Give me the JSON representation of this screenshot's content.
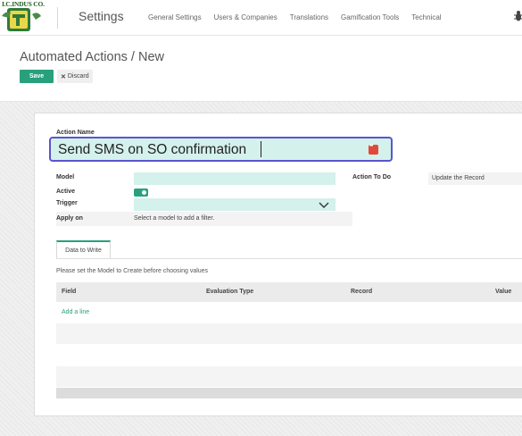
{
  "navbar": {
    "logo_text": "I.C.INDUS CO.",
    "app_title": "Settings",
    "menu": [
      "General Settings",
      "Users & Companies",
      "Translations",
      "Gamification Tools",
      "Technical"
    ],
    "icons": [
      "company-logo",
      "bug-icon"
    ]
  },
  "control_panel": {
    "breadcrumb": "Automated Actions / New",
    "save_label": "Save",
    "discard_label": "Discard"
  },
  "form": {
    "action_name_label": "Action Name",
    "action_name_value": "Send SMS on SO confirmation",
    "model_label": "Model",
    "model_value": "",
    "active_label": "Active",
    "active_value": true,
    "trigger_label": "Trigger",
    "trigger_value": "",
    "apply_on_label": "Apply on",
    "apply_on_value": "Select a model to add a filter.",
    "action_to_do_label": "Action To Do",
    "action_to_do_value": "Update the Record"
  },
  "notebook": {
    "tab_label": "Data to Write",
    "help_text": "Please set the Model to Create before choosing values",
    "columns": [
      "Field",
      "Evaluation Type",
      "Record",
      "Value"
    ],
    "add_line_label": "Add a line"
  },
  "colors": {
    "accent": "#28a07c",
    "focus_border": "#5a55ce",
    "field_bg": "#d4f1ec"
  }
}
